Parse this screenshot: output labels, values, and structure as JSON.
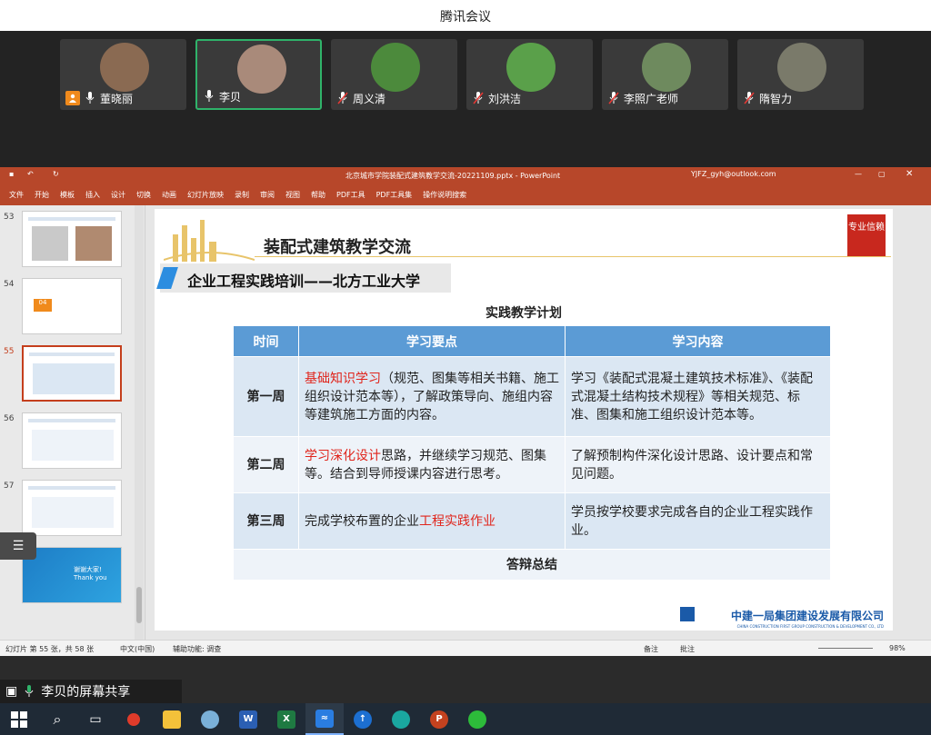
{
  "window": {
    "title": "腾讯会议"
  },
  "participants": [
    {
      "name": "董晓丽",
      "host": true,
      "muted": false,
      "color": "#8a6a52"
    },
    {
      "name": "李贝",
      "host": false,
      "muted": false,
      "active": true,
      "color": "#a98a7a"
    },
    {
      "name": "周义清",
      "host": false,
      "muted": true,
      "color": "#4c8a3c"
    },
    {
      "name": "刘洪洁",
      "host": false,
      "muted": true,
      "color": "#5aa04a"
    },
    {
      "name": "李照广老师",
      "host": false,
      "muted": true,
      "color": "#6e8a5e"
    },
    {
      "name": "隋智力",
      "host": false,
      "muted": true,
      "color": "#7a7a6a"
    }
  ],
  "ppt": {
    "doc_title": "北京城市学院装配式建筑教学交流-20221109.pptx - PowerPoint",
    "account": "YJFZ_gyh@outlook.com",
    "menu": [
      "文件",
      "开始",
      "模板",
      "插入",
      "设计",
      "切换",
      "动画",
      "幻灯片放映",
      "录制",
      "审阅",
      "视图",
      "帮助",
      "PDF工具",
      "PDF工具集",
      "操作说明搜索"
    ],
    "thumb_numbers": [
      "53",
      "54",
      "55",
      "56",
      "57",
      "58"
    ],
    "thumb_58_text": "谢谢大家! Thank you",
    "thumb_54_num": "04",
    "status": {
      "slide_count": "幻灯片 第 55 张，共 58 张",
      "language": "中文(中国)",
      "accessibility": "辅助功能: 调查",
      "notes": "备注",
      "comments": "批注",
      "zoom": "98%"
    }
  },
  "slide": {
    "title": "装配式建筑教学交流",
    "banner": "企业工程实践培训——北方工业大学",
    "plan_title": "实践教学计划",
    "logo_text": "专业信赖",
    "headers": [
      "时间",
      "学习要点",
      "学习内容"
    ],
    "rows": [
      {
        "week": "第一周",
        "point_red": "基础知识学习",
        "point_rest": "（规范、图集等相关书籍、施工组织设计范本等），了解政策导向、施组内容等建筑施工方面的内容。",
        "content": "学习《装配式混凝土建筑技术标准》、《装配式混凝土结构技术规程》等相关规范、标准、图集和施工组织设计范本等。"
      },
      {
        "week": "第二周",
        "point_red": "学习深化设计",
        "point_rest": "思路，并继续学习规范、图集等。结合到导师授课内容进行思考。",
        "content": "了解预制构件深化设计思路、设计要点和常见问题。"
      },
      {
        "week": "第三周",
        "point_pre": "完成学校布置的企业",
        "point_red": "工程实践作业",
        "content": "学员按学校要求完成各自的企业工程实践作业。"
      }
    ],
    "summary": "答辩总结",
    "company": "中建一局集团建设发展有限公司",
    "company_en": "CHINA CONSTRUCTION FIRST GROUP CONSTRUCTION & DEVELOPMENT CO., LTD"
  },
  "share": {
    "label": "李贝的屏幕共享"
  },
  "taskbar": [
    "W",
    "X",
    "P"
  ]
}
